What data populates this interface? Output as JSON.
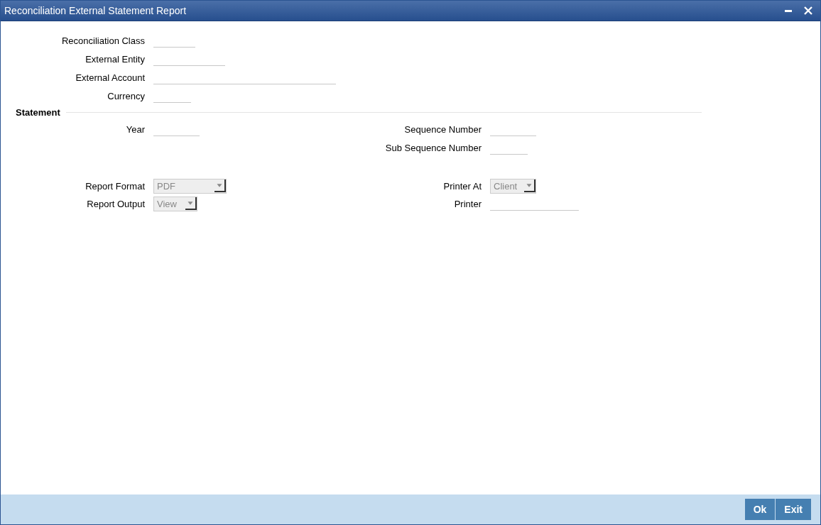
{
  "window": {
    "title": "Reconciliation External Statement Report"
  },
  "main_fields": [
    {
      "label": "Reconciliation Class",
      "kind": "text"
    },
    {
      "label": "External Entity",
      "kind": "text"
    },
    {
      "label": "External Account",
      "kind": "text"
    },
    {
      "label": "Currency",
      "kind": "text"
    }
  ],
  "statement": {
    "title": "Statement",
    "left_fields": [
      {
        "label": "Year",
        "kind": "text"
      }
    ],
    "right_fields": [
      {
        "label": "Sequence Number",
        "kind": "text"
      },
      {
        "label": "Sub Sequence Number",
        "kind": "text"
      }
    ]
  },
  "report": {
    "left_fields": [
      {
        "label": "Report Format",
        "kind": "select",
        "value": "PDF",
        "disabled": true
      },
      {
        "label": "Report Output",
        "kind": "select",
        "value": "View",
        "disabled": true
      }
    ],
    "right_fields": [
      {
        "label": "Printer At",
        "kind": "select",
        "value": "Client",
        "disabled": true
      },
      {
        "label": "Printer",
        "kind": "text"
      }
    ]
  },
  "buttons": [
    "Ok",
    "Exit"
  ]
}
